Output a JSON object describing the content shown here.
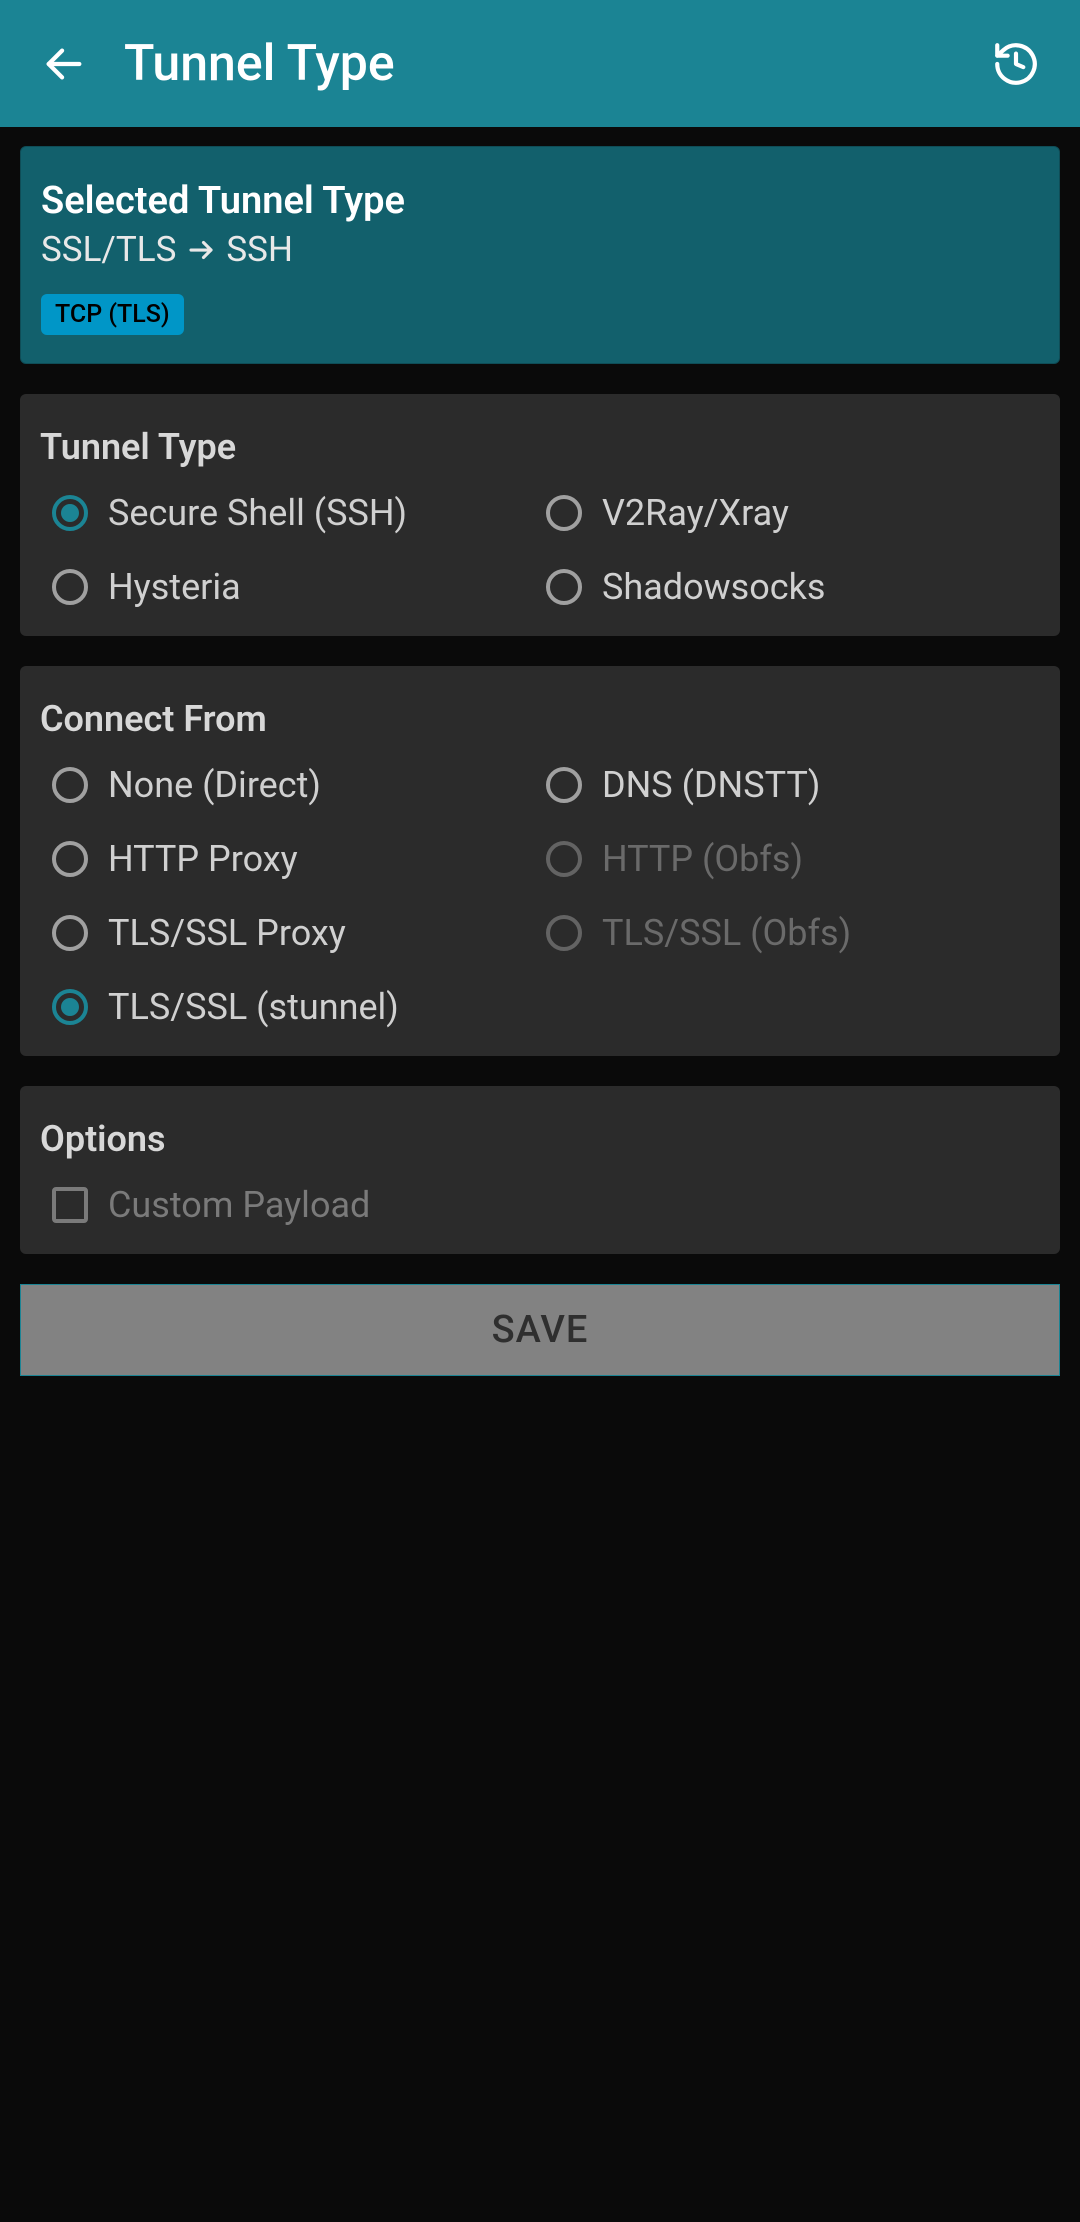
{
  "appbar": {
    "title": "Tunnel Type"
  },
  "selected": {
    "title": "Selected Tunnel Type",
    "from": "SSL/TLS",
    "to": "SSH",
    "badge": "TCP (TLS)"
  },
  "tunnel_section": {
    "title": "Tunnel Type",
    "options": [
      {
        "label": "Secure Shell (SSH)",
        "selected": true,
        "disabled": false
      },
      {
        "label": "V2Ray/Xray",
        "selected": false,
        "disabled": false
      },
      {
        "label": "Hysteria",
        "selected": false,
        "disabled": false
      },
      {
        "label": "Shadowsocks",
        "selected": false,
        "disabled": false
      }
    ]
  },
  "connect_section": {
    "title": "Connect From",
    "options": [
      {
        "label": "None (Direct)",
        "selected": false,
        "disabled": false
      },
      {
        "label": "DNS (DNSTT)",
        "selected": false,
        "disabled": false
      },
      {
        "label": "HTTP Proxy",
        "selected": false,
        "disabled": false
      },
      {
        "label": "HTTP (Obfs)",
        "selected": false,
        "disabled": true
      },
      {
        "label": "TLS/SSL Proxy",
        "selected": false,
        "disabled": false
      },
      {
        "label": "TLS/SSL (Obfs)",
        "selected": false,
        "disabled": true
      },
      {
        "label": "TLS/SSL (stunnel)",
        "selected": true,
        "disabled": false
      }
    ]
  },
  "options_section": {
    "title": "Options",
    "custom_payload_label": "Custom Payload",
    "custom_payload_checked": false
  },
  "save_label": "SAVE"
}
